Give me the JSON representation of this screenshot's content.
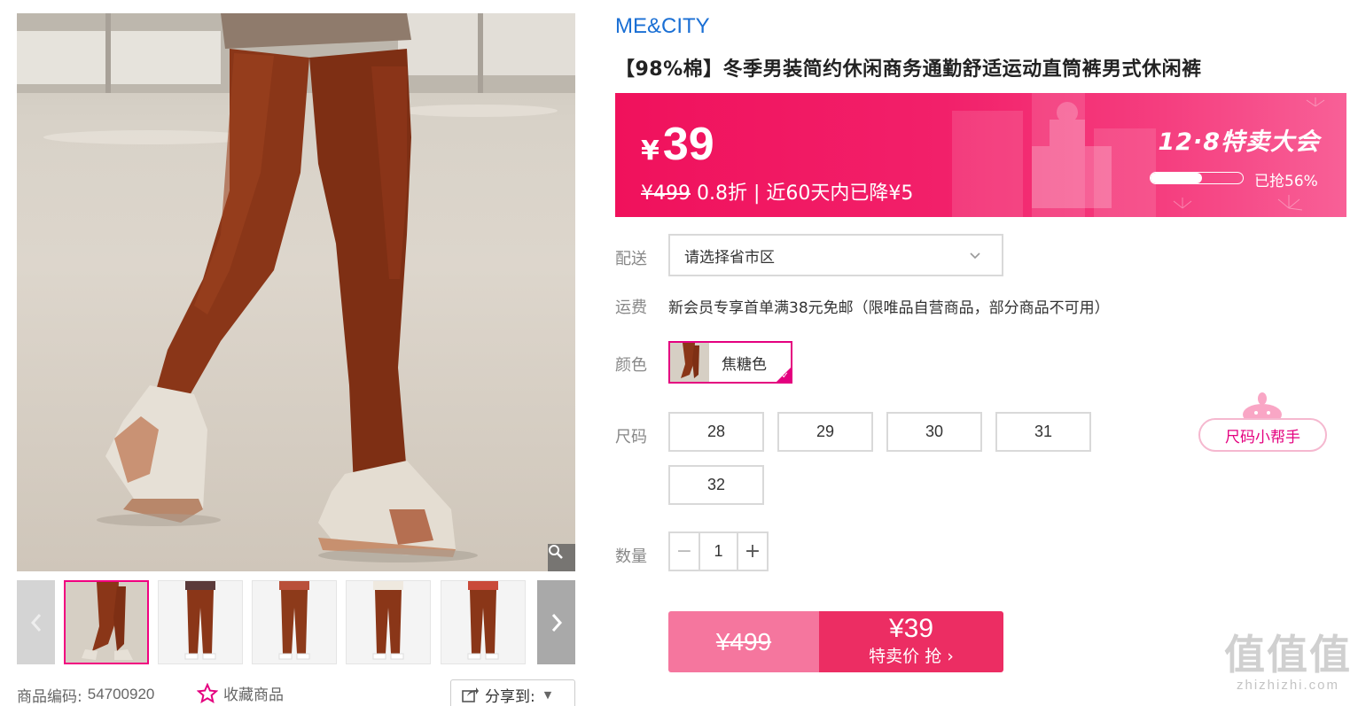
{
  "gallery": {
    "product_code_label": "商品编码:",
    "product_code": "54700920",
    "favorite_label": "收藏商品",
    "share_label": "分享到:"
  },
  "product": {
    "brand": "ME&CITY",
    "title": "【98%棉】冬季男装简约休闲商务通勤舒适运动直筒裤男式休闲裤"
  },
  "banner": {
    "currency": "¥",
    "price": "39",
    "original_price": "¥499",
    "discount": " 0.8折 | 近60天内已降¥5",
    "event_name": "12·8特卖大会",
    "progress_label": "已抢56%",
    "progress_fraction": 0.56
  },
  "delivery": {
    "label": "配送",
    "placeholder": "请选择省市区"
  },
  "shipping": {
    "label": "运费",
    "text": "新会员专享首单满38元免邮（限唯品自营商品，部分商品不可用）"
  },
  "color": {
    "label": "颜色",
    "selected": "焦糖色"
  },
  "size": {
    "label": "尺码",
    "options": [
      "28",
      "29",
      "30",
      "31",
      "32"
    ],
    "helper_label": "尺码小帮手"
  },
  "quantity": {
    "label": "数量",
    "minus": "−",
    "value": "1",
    "plus": "+"
  },
  "buy": {
    "original_price": "¥499",
    "price": "¥39",
    "label": "特卖价 抢 ›"
  },
  "watermark": {
    "big": "值值值",
    "small": "zhizhizhi.com"
  }
}
